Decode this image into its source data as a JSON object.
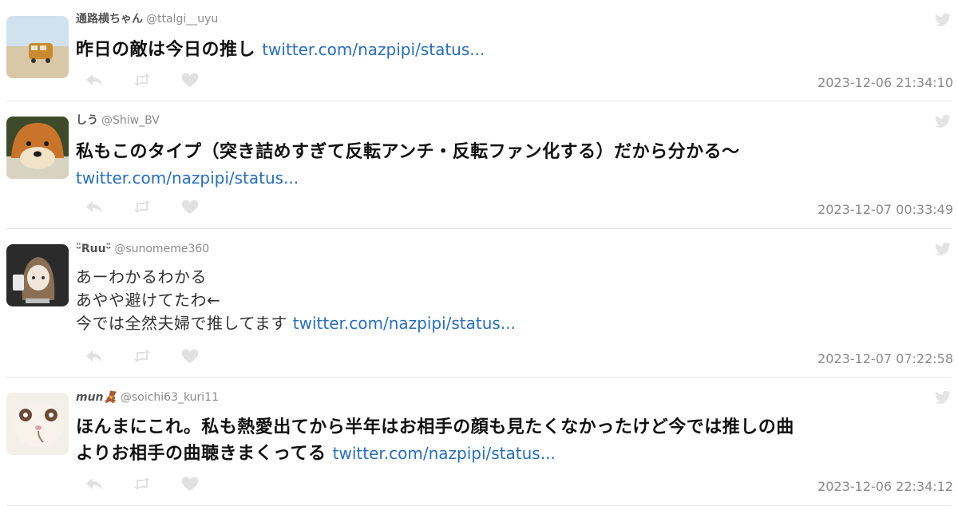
{
  "tweets": [
    {
      "name": "通路横ちゃん",
      "handle": "@ttalgi__uyu",
      "lines": [
        "昨日の敵は今日の推し"
      ],
      "link": "twitter.com/nazpipi/status...",
      "timestamp": "2023-12-06 21:34:10"
    },
    {
      "name": "しう",
      "handle": "@Shiw_BV",
      "lines": [
        "私もこのタイプ（突き詰めすぎて反転アンチ・反転ファン化する）だから分かる〜"
      ],
      "link": "twitter.com/nazpipi/status...",
      "timestamp": "2023-12-07 00:33:49"
    },
    {
      "name": "ᵕ̈Ruuᵕ̈",
      "handle": "@sunomeme360",
      "lines": [
        "あーわかるわかる",
        "あやや避けてたわ←",
        "今では全然夫婦で推してます"
      ],
      "link": "twitter.com/nazpipi/status...",
      "timestamp": "2023-12-07 07:22:58"
    },
    {
      "name": "mun🧸",
      "handle": "@soichi63_kuri11",
      "lines": [
        "ほんまにこれ。私も熱愛出てから半年はお相手の顔も見たくなかったけど今では推しの曲",
        "よりお相手の曲聴きまくってる"
      ],
      "link": "twitter.com/nazpipi/status...",
      "timestamp": "2023-12-06 22:34:12"
    }
  ],
  "icons": {
    "reply": "reply-icon",
    "retweet": "retweet-icon",
    "like": "heart-icon",
    "source": "twitter-bird-icon"
  },
  "colors": {
    "link": "#2a6eb7",
    "icon": "#e1e1e1",
    "timestamp": "#8a8a8a"
  }
}
